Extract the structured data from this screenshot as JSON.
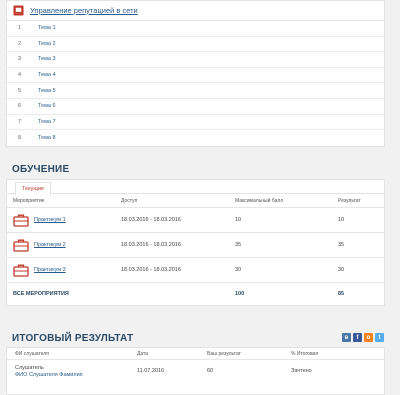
{
  "course": {
    "title": "Управление репутацией в сети",
    "topics": [
      {
        "num": "1",
        "label": "Тема 1"
      },
      {
        "num": "2",
        "label": "Тема 2"
      },
      {
        "num": "3",
        "label": "Тема 3"
      },
      {
        "num": "4",
        "label": "Тема 4"
      },
      {
        "num": "5",
        "label": "Тема 5"
      },
      {
        "num": "6",
        "label": "Тема 6"
      },
      {
        "num": "7",
        "label": "Тема 7"
      },
      {
        "num": "8",
        "label": "Тема 8"
      }
    ]
  },
  "learning": {
    "title": "ОБУЧЕНИЕ",
    "tab": "Текущие",
    "headers": [
      "Мероприятие",
      "Доступ",
      "Максимальный балл",
      "Результат"
    ],
    "events": [
      {
        "name": "Практикум 1",
        "access": "18.03.2016 - 18.03.2016",
        "max": "10",
        "result": "10"
      },
      {
        "name": "Практикум 2",
        "access": "18.03.2016 - 18.03.2016",
        "max": "35",
        "result": "35"
      },
      {
        "name": "Практикум 3",
        "access": "18.03.2016 - 18.03.2016",
        "max": "30",
        "result": "30"
      }
    ],
    "total": {
      "label": "ВСЕ МЕРОПРИЯТИЯ",
      "max": "100",
      "result": "85"
    }
  },
  "final": {
    "title": "ИТОГОВЫЙ РЕЗУЛЬТАТ",
    "headers": [
      "ФИ слушателя",
      "Дата",
      "Ваш результат",
      "% Итоговая"
    ],
    "row": {
      "name": "Слушатель",
      "sub": "ФИО Слушателя Фамилия",
      "date": "11.07.2016",
      "score": "60",
      "status": "Зачтено"
    }
  },
  "social": [
    {
      "icon": "vk-icon",
      "glyph": "в",
      "color": "#4a76a8"
    },
    {
      "icon": "facebook-icon",
      "glyph": "f",
      "color": "#3b5998"
    },
    {
      "icon": "odnoklassniki-icon",
      "glyph": "о",
      "color": "#f58220"
    },
    {
      "icon": "twitter-icon",
      "glyph": "t",
      "color": "#55acee"
    }
  ],
  "colors": {
    "accent": "#c0392b",
    "link": "#2a5c8f",
    "heading": "#2b4a66"
  }
}
